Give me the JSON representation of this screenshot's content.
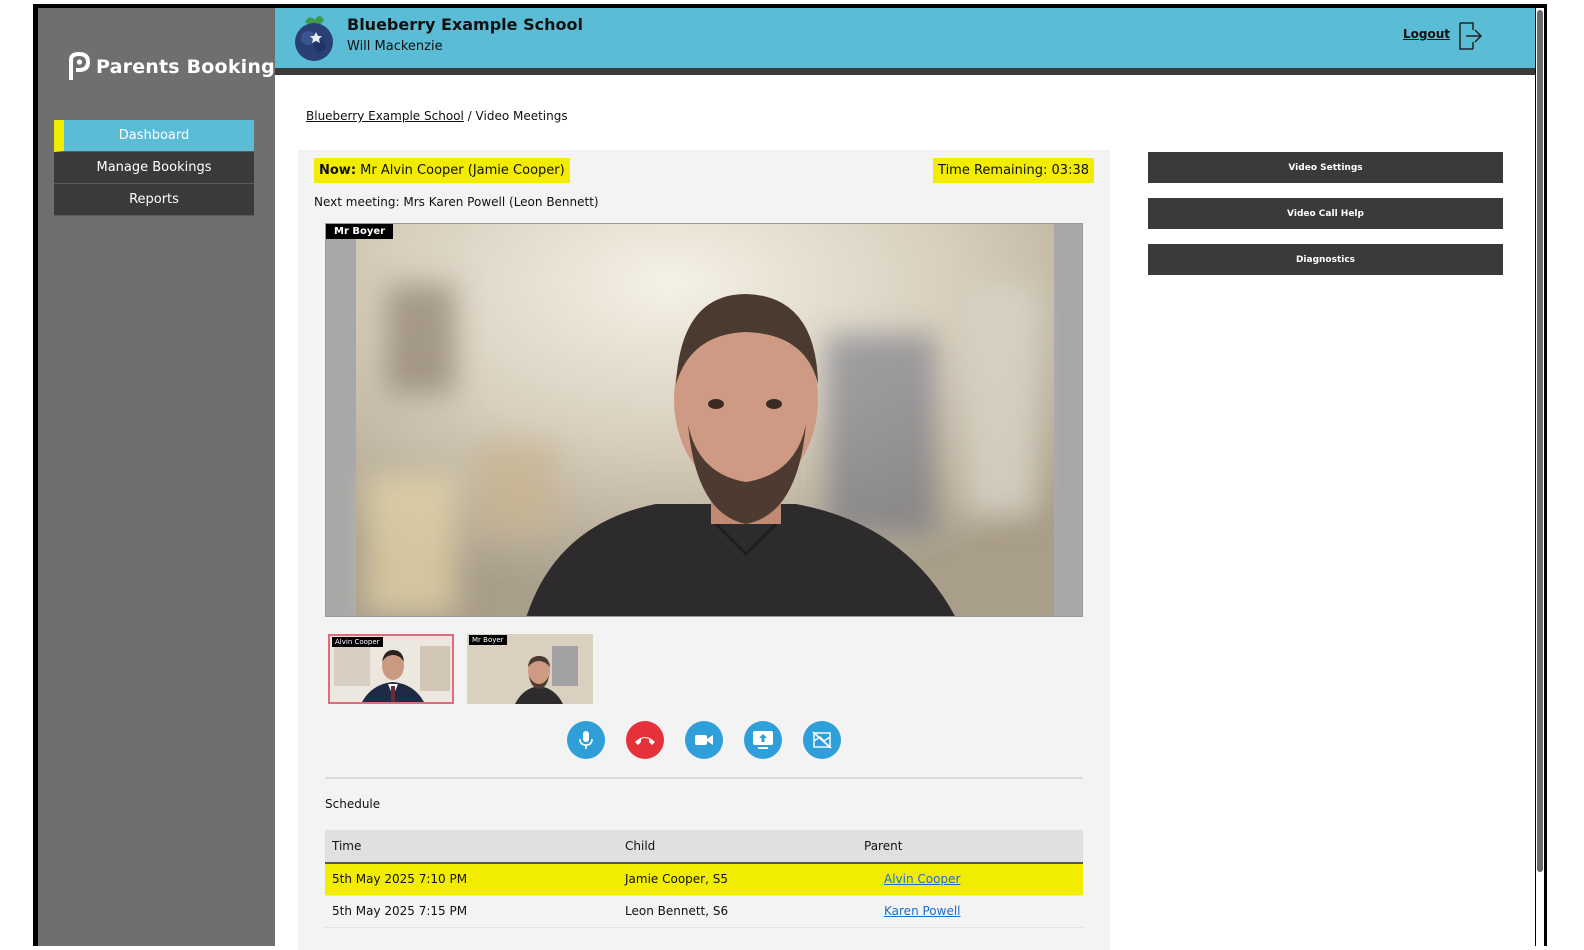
{
  "sidebar": {
    "brand": "Parents Booking",
    "items": [
      {
        "label": "Dashboard"
      },
      {
        "label": "Manage Bookings"
      },
      {
        "label": "Reports"
      }
    ]
  },
  "header": {
    "school": "Blueberry Example School",
    "user": "Will Mackenzie",
    "logout": "Logout"
  },
  "breadcrumb": {
    "root": "Blueberry Example School",
    "sep": "/",
    "current": "Video Meetings"
  },
  "meeting": {
    "now_prefix": "Now:",
    "now_value": "Mr Alvin Cooper (Jamie Cooper)",
    "time_remaining": "Time Remaining: 03:38",
    "next": "Next meeting: Mrs Karen Powell (Leon Bennett)",
    "main_video_tag": "Mr Boyer",
    "thumbs": [
      {
        "tag": "Alvin Cooper"
      },
      {
        "tag": "Mr Boyer"
      }
    ]
  },
  "controls": [
    "microphone-icon",
    "hang-up-icon",
    "camera-icon",
    "screen-share-icon",
    "background-blur-off-icon"
  ],
  "schedule": {
    "title": "Schedule",
    "columns": [
      "Time",
      "Child",
      "Parent"
    ],
    "rows": [
      {
        "time": "5th May 2025 7:10 PM",
        "child": "Jamie Cooper, S5",
        "parent": "Alvin Cooper"
      },
      {
        "time": "5th May 2025 7:15 PM",
        "child": "Leon Bennett, S6",
        "parent": "Karen Powell"
      }
    ]
  },
  "side_buttons": [
    {
      "label": "Video Settings"
    },
    {
      "label": "Video Call Help"
    },
    {
      "label": "Diagnostics"
    }
  ],
  "colors": {
    "accent": "#5bbcd6",
    "highlight": "#f2ed00",
    "dark": "#3a3a3a",
    "control_blue": "#2e9fd9",
    "control_red": "#e7313a"
  }
}
